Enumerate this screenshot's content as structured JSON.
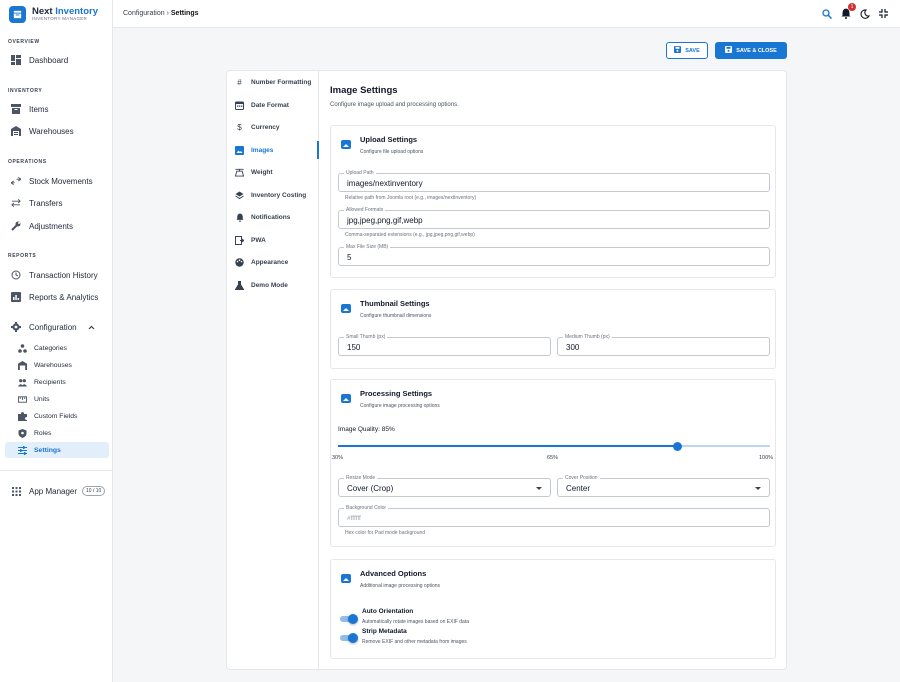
{
  "brand": {
    "title_main": "Next",
    "title_accent": "Inventory",
    "subtitle": "INVENTORY MANAGER"
  },
  "sidebar": {
    "sections": {
      "overview": "OVERVIEW",
      "inventory": "INVENTORY",
      "operations": "OPERATIONS",
      "reports": "REPORTS"
    },
    "items": {
      "dashboard": "Dashboard",
      "items": "Items",
      "warehouses": "Warehouses",
      "stock_movements": "Stock Movements",
      "transfers": "Transfers",
      "adjustments": "Adjustments",
      "transaction_history": "Transaction History",
      "reports_analytics": "Reports & Analytics",
      "configuration": "Configuration",
      "app_manager": "App Manager",
      "app_manager_badge": "10 / 10"
    },
    "config_items": {
      "categories": "Categories",
      "warehouses": "Warehouses",
      "recipients": "Recipients",
      "units": "Units",
      "custom_fields": "Custom Fields",
      "roles": "Roles",
      "settings": "Settings"
    }
  },
  "topbar": {
    "breadcrumb_parent": "Configuration",
    "breadcrumb_sep": "›",
    "breadcrumb_current": "Settings",
    "notification_count": "1"
  },
  "actions": {
    "save": "SAVE",
    "save_close": "SAVE & CLOSE"
  },
  "settings_nav": {
    "number_formatting": "Number Formatting",
    "date_format": "Date Format",
    "currency": "Currency",
    "images": "Images",
    "weight": "Weight",
    "inventory_costing": "Inventory Costing",
    "notifications": "Notifications",
    "pwa": "PWA",
    "appearance": "Appearance",
    "demo_mode": "Demo Mode"
  },
  "main": {
    "title": "Image Settings",
    "description": "Configure image upload and processing options.",
    "upload": {
      "title": "Upload Settings",
      "subtitle": "Configure file upload options",
      "path_label": "Upload Path",
      "path_value": "images/nextinventory",
      "path_help": "Relative path from Joomla root (e.g., images/nextinventory)",
      "formats_label": "Allowed Formats",
      "formats_value": "jpg,jpeg,png,gif,webp",
      "formats_help": "Comma-separated extensions (e.g., jpg,jpeg,png,gif,webp)",
      "max_label": "Max File Size (MB)",
      "max_value": "5"
    },
    "thumbnail": {
      "title": "Thumbnail Settings",
      "subtitle": "Configure thumbnail dimensions",
      "small_label": "Small Thumb (px)",
      "small_value": "150",
      "medium_label": "Medium Thumb (px)",
      "medium_value": "300"
    },
    "processing": {
      "title": "Processing Settings",
      "subtitle": "Configure image processing options",
      "quality_label": "Image Quality: 85%",
      "quality_value": 85,
      "quality_min": 30,
      "quality_max": 100,
      "mark_min": "30%",
      "mark_mid": "65%",
      "mark_max": "100%",
      "resize_label": "Resize Mode",
      "resize_value": "Cover (Crop)",
      "cover_label": "Cover Position",
      "cover_value": "Center",
      "bg_label": "Background Color",
      "bg_placeholder": "#ffffff",
      "bg_help": "Hex color for Pad mode background"
    },
    "advanced": {
      "title": "Advanced Options",
      "subtitle": "Additional image processing options",
      "auto_title": "Auto Orientation",
      "auto_desc": "Automatically rotate images based on EXIF data",
      "strip_title": "Strip Metadata",
      "strip_desc": "Remove EXIF and other metadata from images"
    }
  },
  "colors": {
    "accent": "#1976d2",
    "active_bg": "#e3eefb",
    "badge_red": "#d32f2f"
  }
}
